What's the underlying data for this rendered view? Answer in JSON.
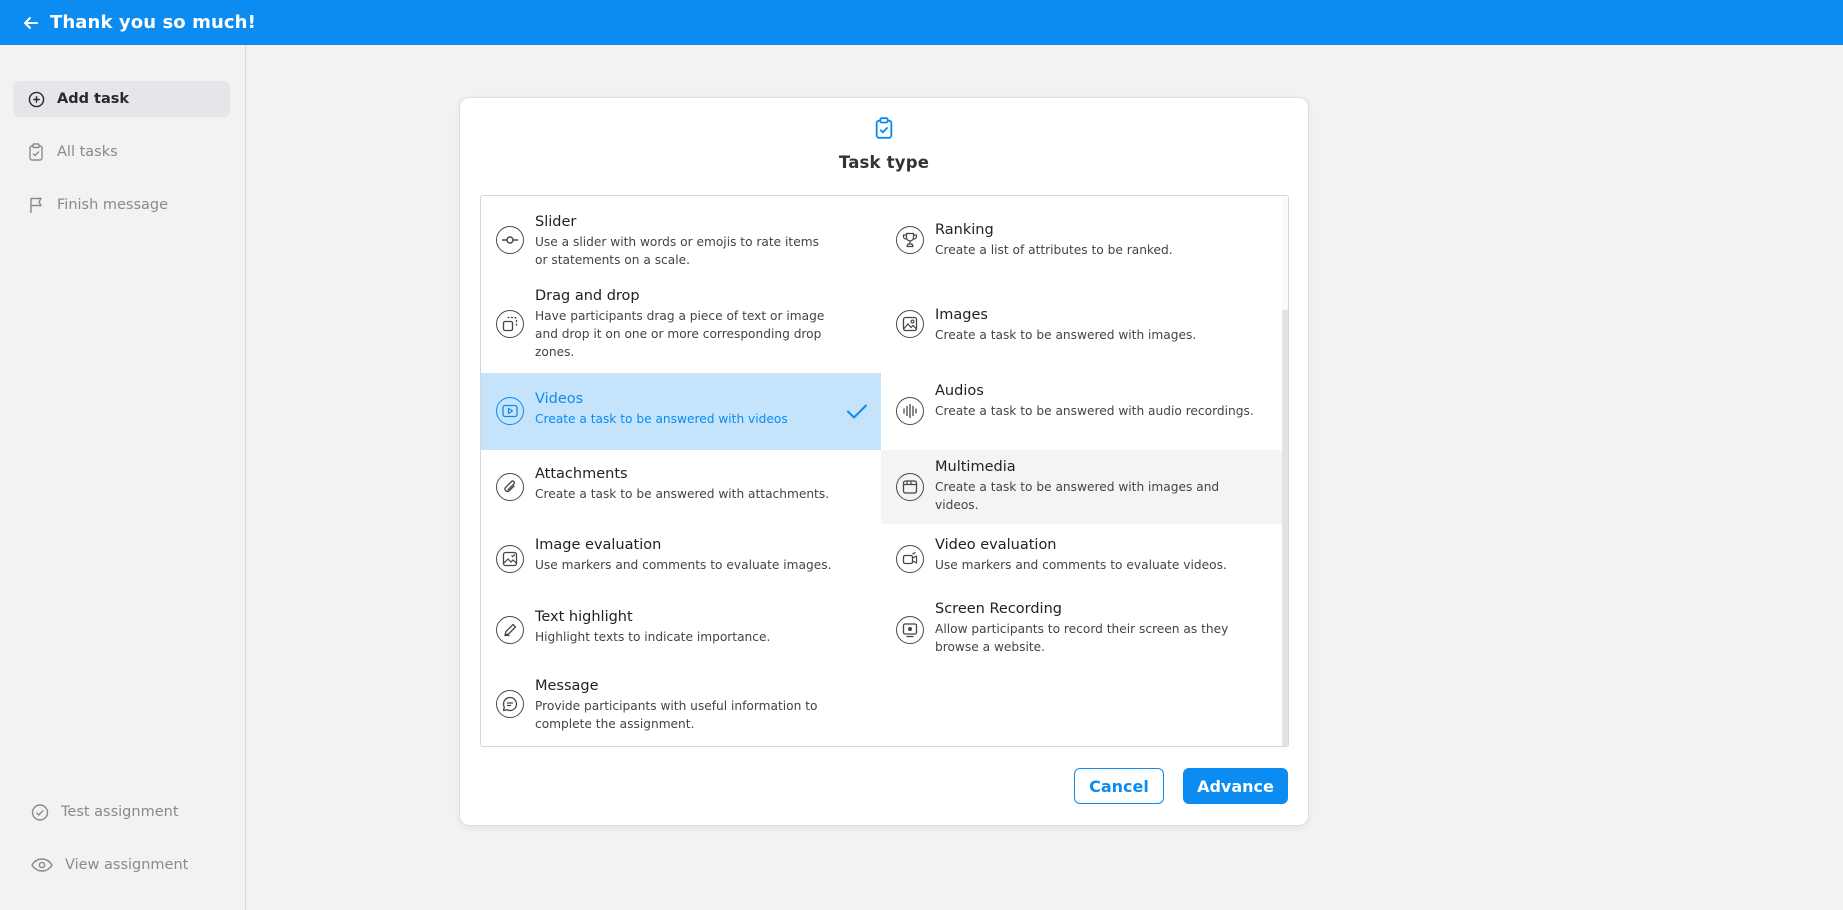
{
  "header": {
    "title": "Thank you so much!"
  },
  "sidebar": {
    "items": [
      {
        "label": "Add task",
        "icon": "plus-circle-icon"
      },
      {
        "label": "All tasks",
        "icon": "clipboard-icon"
      },
      {
        "label": "Finish message",
        "icon": "flag-icon"
      }
    ],
    "bottom": [
      {
        "label": "Test assignment",
        "icon": "check-circle-icon"
      },
      {
        "label": "View assignment",
        "icon": "eye-icon"
      }
    ]
  },
  "modal": {
    "title": "Task type",
    "options": [
      {
        "title": "Slider",
        "desc": "Use a slider with words or emojis to rate items or statements on a scale."
      },
      {
        "title": "Ranking",
        "desc": "Create a list of attributes to be ranked."
      },
      {
        "title": "Drag and drop",
        "desc": "Have participants drag a piece of text or image and drop it on one or more corresponding drop zones."
      },
      {
        "title": "Images",
        "desc": "Create a task to be answered with images."
      },
      {
        "title": "Videos",
        "desc": "Create a task to be answered with videos"
      },
      {
        "title": "Audios",
        "desc": "Create a task to be answered with audio recordings."
      },
      {
        "title": "Attachments",
        "desc": "Create a task to be answered with attachments."
      },
      {
        "title": "Multimedia",
        "desc": "Create a task to be answered with images and videos."
      },
      {
        "title": "Image evaluation",
        "desc": "Use markers and comments to evaluate images."
      },
      {
        "title": "Video evaluation",
        "desc": "Use markers and comments to evaluate videos."
      },
      {
        "title": "Text highlight",
        "desc": "Highlight texts to indicate importance."
      },
      {
        "title": "Screen Recording",
        "desc": "Allow participants to record their screen as they browse a website."
      },
      {
        "title": "Message",
        "desc": "Provide participants with useful information to complete the assignment."
      }
    ],
    "selected": "Videos",
    "cancel_label": "Cancel",
    "advance_label": "Advance"
  },
  "colors": {
    "accent": "#0c8cf0",
    "selected_bg": "#c5e3fa",
    "background": "#f2f2f2"
  }
}
